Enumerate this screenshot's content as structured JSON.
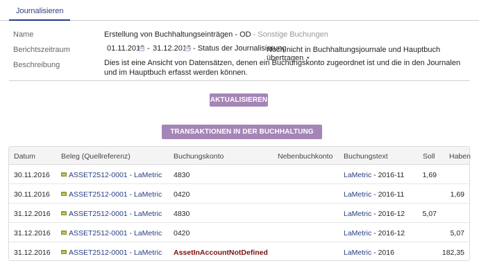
{
  "tabs": [
    {
      "label": "Journalisieren"
    }
  ],
  "form": {
    "name_label": "Name",
    "name_value": "Erstellung von Buchhaltungseinträgen - OD",
    "name_suffix": "- Sonstige Buchungen",
    "period_label": "Berichtszeitraum",
    "date_from": "01.11.2010",
    "date_separator": "-",
    "date_to": "31.12.2016",
    "status_label": "- Status der Journalisierung",
    "status_value": "Noch nicht in Buchhaltungsjournale und Hauptbuch übertragen",
    "description_label": "Beschreibung",
    "description_value": "Dies ist eine Ansicht von Datensätzen, denen ein Buchungskonto zugeordnet ist und die in den Journalen und im Hauptbuch erfasst werden können."
  },
  "buttons": {
    "refresh": "AKTUALISIEREN",
    "record": "TRANSAKTIONEN IN DER BUCHHALTUNG ERFASSEN"
  },
  "table": {
    "headers": {
      "datum": "Datum",
      "beleg": "Beleg (Quellreferenz)",
      "konto": "Buchungskonto",
      "nebenkonto": "Nebenbuchkonto",
      "text": "Buchungstext",
      "soll": "Soll",
      "haben": "Haben"
    },
    "rows": [
      {
        "datum": "30.11.2016",
        "beleg": "ASSET2512-0001 - LaMetric",
        "konto": "4830",
        "nebenkonto": "",
        "text_link": "LaMetric",
        "text_rest": " - 2016-11",
        "soll": "1,69",
        "haben": ""
      },
      {
        "datum": "30.11.2016",
        "beleg": "ASSET2512-0001 - LaMetric",
        "konto": "0420",
        "nebenkonto": "",
        "text_link": "LaMetric",
        "text_rest": " - 2016-11",
        "soll": "",
        "haben": "1,69"
      },
      {
        "datum": "31.12.2016",
        "beleg": "ASSET2512-0001 - LaMetric",
        "konto": "4830",
        "nebenkonto": "",
        "text_link": "LaMetric",
        "text_rest": " - 2016-12",
        "soll": "5,07",
        "haben": ""
      },
      {
        "datum": "31.12.2016",
        "beleg": "ASSET2512-0001 - LaMetric",
        "konto": "0420",
        "nebenkonto": "",
        "text_link": "LaMetric",
        "text_rest": " - 2016-12",
        "soll": "",
        "haben": "5,07"
      },
      {
        "datum": "31.12.2016",
        "beleg": "ASSET2512-0001 - LaMetric",
        "konto": "AssetInAccountNotDefined",
        "nebenkonto": "",
        "text_link": "LaMetric",
        "text_rest": " - 2016",
        "soll": "",
        "haben": "182,35"
      }
    ]
  },
  "icons": {
    "calendar": "calendar-icon",
    "document": "document-icon",
    "caret": "chevron-down-icon"
  },
  "colors": {
    "tab_active": "#263c81",
    "button": "#a585b6",
    "link": "#263c81",
    "error": "#7a1010"
  }
}
